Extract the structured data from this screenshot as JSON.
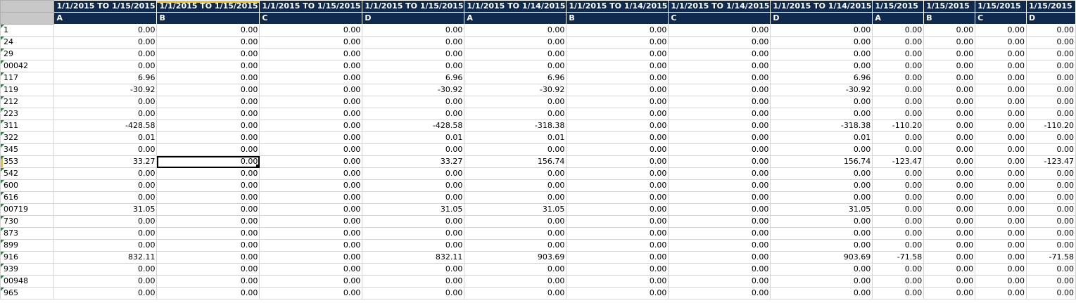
{
  "header_periods": [
    "1/1/2015 TO 1/15/2015",
    "1/1/2015 TO 1/15/2015",
    "1/1/2015 TO 1/15/2015",
    "1/1/2015 TO 1/15/2015",
    "1/1/2015 TO 1/14/2015",
    "1/1/2015 TO 1/14/2015",
    "1/1/2015 TO 1/14/2015",
    "1/1/2015 TO 1/14/2015",
    "1/15/2015",
    "1/15/2015",
    "1/15/2015",
    "1/15/2015"
  ],
  "header_codes": [
    "A",
    "B",
    "C",
    "D",
    "A",
    "B",
    "C",
    "D",
    "A",
    "B",
    "C",
    "D"
  ],
  "rows": [
    {
      "key": "1",
      "values": [
        "0.00",
        "0.00",
        "0.00",
        "0.00",
        "0.00",
        "0.00",
        "0.00",
        "0.00",
        "0.00",
        "0.00",
        "0.00",
        "0.00"
      ]
    },
    {
      "key": "24",
      "values": [
        "0.00",
        "0.00",
        "0.00",
        "0.00",
        "0.00",
        "0.00",
        "0.00",
        "0.00",
        "0.00",
        "0.00",
        "0.00",
        "0.00"
      ]
    },
    {
      "key": "29",
      "values": [
        "0.00",
        "0.00",
        "0.00",
        "0.00",
        "0.00",
        "0.00",
        "0.00",
        "0.00",
        "0.00",
        "0.00",
        "0.00",
        "0.00"
      ]
    },
    {
      "key": "00042",
      "values": [
        "0.00",
        "0.00",
        "0.00",
        "0.00",
        "0.00",
        "0.00",
        "0.00",
        "0.00",
        "0.00",
        "0.00",
        "0.00",
        "0.00"
      ]
    },
    {
      "key": "117",
      "values": [
        "6.96",
        "0.00",
        "0.00",
        "6.96",
        "6.96",
        "0.00",
        "0.00",
        "6.96",
        "0.00",
        "0.00",
        "0.00",
        "0.00"
      ]
    },
    {
      "key": "119",
      "values": [
        "-30.92",
        "0.00",
        "0.00",
        "-30.92",
        "-30.92",
        "0.00",
        "0.00",
        "-30.92",
        "0.00",
        "0.00",
        "0.00",
        "0.00"
      ]
    },
    {
      "key": "212",
      "values": [
        "0.00",
        "0.00",
        "0.00",
        "0.00",
        "0.00",
        "0.00",
        "0.00",
        "0.00",
        "0.00",
        "0.00",
        "0.00",
        "0.00"
      ]
    },
    {
      "key": "223",
      "values": [
        "0.00",
        "0.00",
        "0.00",
        "0.00",
        "0.00",
        "0.00",
        "0.00",
        "0.00",
        "0.00",
        "0.00",
        "0.00",
        "0.00"
      ]
    },
    {
      "key": "311",
      "values": [
        "-428.58",
        "0.00",
        "0.00",
        "-428.58",
        "-318.38",
        "0.00",
        "0.00",
        "-318.38",
        "-110.20",
        "0.00",
        "0.00",
        "-110.20"
      ]
    },
    {
      "key": "322",
      "values": [
        "0.01",
        "0.00",
        "0.00",
        "0.01",
        "0.01",
        "0.00",
        "0.00",
        "0.01",
        "0.00",
        "0.00",
        "0.00",
        "0.00"
      ]
    },
    {
      "key": "345",
      "values": [
        "0.00",
        "0.00",
        "0.00",
        "0.00",
        "0.00",
        "0.00",
        "0.00",
        "0.00",
        "0.00",
        "0.00",
        "0.00",
        "0.00"
      ]
    },
    {
      "key": "353",
      "values": [
        "33.27",
        "0.00",
        "0.00",
        "33.27",
        "156.74",
        "0.00",
        "0.00",
        "156.74",
        "-123.47",
        "0.00",
        "0.00",
        "-123.47"
      ]
    },
    {
      "key": "542",
      "values": [
        "0.00",
        "0.00",
        "0.00",
        "0.00",
        "0.00",
        "0.00",
        "0.00",
        "0.00",
        "0.00",
        "0.00",
        "0.00",
        "0.00"
      ]
    },
    {
      "key": "600",
      "values": [
        "0.00",
        "0.00",
        "0.00",
        "0.00",
        "0.00",
        "0.00",
        "0.00",
        "0.00",
        "0.00",
        "0.00",
        "0.00",
        "0.00"
      ]
    },
    {
      "key": "616",
      "values": [
        "0.00",
        "0.00",
        "0.00",
        "0.00",
        "0.00",
        "0.00",
        "0.00",
        "0.00",
        "0.00",
        "0.00",
        "0.00",
        "0.00"
      ]
    },
    {
      "key": "00719",
      "values": [
        "31.05",
        "0.00",
        "0.00",
        "31.05",
        "31.05",
        "0.00",
        "0.00",
        "31.05",
        "0.00",
        "0.00",
        "0.00",
        "0.00"
      ]
    },
    {
      "key": "730",
      "values": [
        "0.00",
        "0.00",
        "0.00",
        "0.00",
        "0.00",
        "0.00",
        "0.00",
        "0.00",
        "0.00",
        "0.00",
        "0.00",
        "0.00"
      ]
    },
    {
      "key": "873",
      "values": [
        "0.00",
        "0.00",
        "0.00",
        "0.00",
        "0.00",
        "0.00",
        "0.00",
        "0.00",
        "0.00",
        "0.00",
        "0.00",
        "0.00"
      ]
    },
    {
      "key": "899",
      "values": [
        "0.00",
        "0.00",
        "0.00",
        "0.00",
        "0.00",
        "0.00",
        "0.00",
        "0.00",
        "0.00",
        "0.00",
        "0.00",
        "0.00"
      ]
    },
    {
      "key": "916",
      "values": [
        "832.11",
        "0.00",
        "0.00",
        "832.11",
        "903.69",
        "0.00",
        "0.00",
        "903.69",
        "-71.58",
        "0.00",
        "0.00",
        "-71.58"
      ]
    },
    {
      "key": "939",
      "values": [
        "0.00",
        "0.00",
        "0.00",
        "0.00",
        "0.00",
        "0.00",
        "0.00",
        "0.00",
        "0.00",
        "0.00",
        "0.00",
        "0.00"
      ]
    },
    {
      "key": "00948",
      "values": [
        "0.00",
        "0.00",
        "0.00",
        "0.00",
        "0.00",
        "0.00",
        "0.00",
        "0.00",
        "0.00",
        "0.00",
        "0.00",
        "0.00"
      ]
    },
    {
      "key": "965",
      "values": [
        "0.00",
        "0.00",
        "0.00",
        "0.00",
        "0.00",
        "0.00",
        "0.00",
        "0.00",
        "0.00",
        "0.00",
        "0.00",
        "0.00"
      ]
    }
  ],
  "selection": {
    "row_key": "353",
    "column": "B"
  },
  "colors": {
    "header_bg": "#0f2a4e",
    "header_text": "#ffffff",
    "selection_accent": "#f2c21b",
    "error_flag": "#1f8a3b"
  }
}
